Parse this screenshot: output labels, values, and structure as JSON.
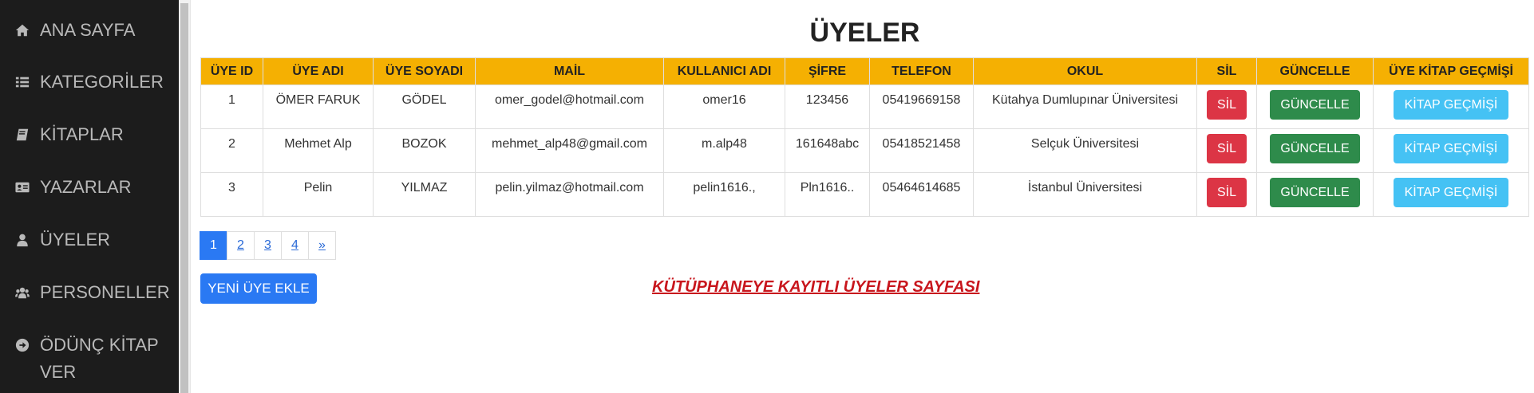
{
  "sidebar": {
    "items": [
      {
        "label": "ANA SAYFA",
        "icon": "home-icon"
      },
      {
        "label": "KATEGORİLER",
        "icon": "list-icon"
      },
      {
        "label": "KİTAPLAR",
        "icon": "book-icon"
      },
      {
        "label": "YAZARLAR",
        "icon": "id-card-icon"
      },
      {
        "label": "ÜYELER",
        "icon": "user-icon"
      },
      {
        "label": "PERSONELLER",
        "icon": "users-icon"
      },
      {
        "label": "ÖDÜNÇ KİTAP VER",
        "icon": "arrow-circle-right-icon"
      }
    ]
  },
  "main": {
    "title": "ÜYELER",
    "table": {
      "headers": [
        "ÜYE ID",
        "ÜYE ADI",
        "ÜYE SOYADI",
        "MAİL",
        "KULLANICI ADI",
        "ŞİFRE",
        "TELEFON",
        "OKUL",
        "SİL",
        "GÜNCELLE",
        "ÜYE KİTAP GEÇMİŞİ"
      ],
      "rows": [
        {
          "id": "1",
          "name": "ÖMER FARUK",
          "surname": "GÖDEL",
          "mail": "omer_godel@hotmail.com",
          "username": "omer16",
          "password": "123456",
          "phone": "05419669158",
          "school": "Kütahya Dumlupınar Üniversitesi"
        },
        {
          "id": "2",
          "name": "Mehmet Alp",
          "surname": "BOZOK",
          "mail": "mehmet_alp48@gmail.com",
          "username": "m.alp48",
          "password": "161648abc",
          "phone": "05418521458",
          "school": "Selçuk Üniversitesi"
        },
        {
          "id": "3",
          "name": "Pelin",
          "surname": "YILMAZ",
          "mail": "pelin.yilmaz@hotmail.com",
          "username": "pelin1616.,",
          "password": "Pln1616..",
          "phone": "05464614685",
          "school": "İstanbul Üniversitesi"
        }
      ],
      "delete_label": "SİL",
      "update_label": "GÜNCELLE",
      "history_label": "KİTAP GEÇMİŞİ"
    },
    "pagination": {
      "pages": [
        "1",
        "2",
        "3",
        "4"
      ],
      "next": "»",
      "active": "1"
    },
    "add_button": "YENİ ÜYE EKLE",
    "caption": "KÜTÜPHANEYE KAYITLI ÜYELER SAYFASI"
  },
  "colors": {
    "sidebar_bg": "#1c1c1c",
    "header_bg": "#f5b002",
    "danger": "#dc3545",
    "success": "#2e8b4b",
    "info": "#45c2f4",
    "primary": "#2a79f3",
    "caption": "#c8161d"
  }
}
